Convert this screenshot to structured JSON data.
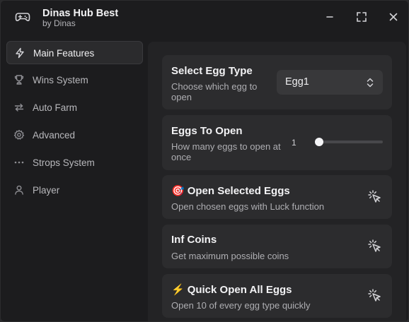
{
  "window": {
    "title": "Dinas Hub Best",
    "subtitle": "by Dinas",
    "icon": "gamepad-icon",
    "controls": [
      "minimize-icon",
      "maximize-icon",
      "close-icon"
    ]
  },
  "sidebar": {
    "items": [
      {
        "label": "Main Features",
        "icon": "lightning-icon",
        "active": true
      },
      {
        "label": "Wins System",
        "icon": "trophy-icon",
        "active": false
      },
      {
        "label": "Auto Farm",
        "icon": "repeat-icon",
        "active": false
      },
      {
        "label": "Advanced",
        "icon": "gear-icon",
        "active": false
      },
      {
        "label": "Strops System",
        "icon": "ellipsis-icon",
        "active": false
      },
      {
        "label": "Player",
        "icon": "user-icon",
        "active": false
      }
    ]
  },
  "main": {
    "egg_type": {
      "title": "Select Egg Type",
      "description": "Choose which egg to open",
      "selected": "Egg1"
    },
    "eggs_to_open": {
      "title": "Eggs To Open",
      "description": "How many eggs to open at once",
      "value": "1",
      "level": 0
    },
    "open_selected": {
      "emoji": "🎯",
      "title": "Open Selected Eggs",
      "description": "Open chosen eggs with Luck function"
    },
    "inf_coins": {
      "title": "Inf Coins",
      "description": "Get maximum possible coins"
    },
    "quick_open": {
      "emoji": "⚡",
      "title": "Quick Open All Eggs",
      "description": "Open 10 of every egg type quickly"
    }
  },
  "colors": {
    "window_bg": "#1c1c1e",
    "panel_bg": "#232325",
    "card_bg": "#2c2c2e",
    "text": "#f2f2f4",
    "muted_text": "#aeaeb2"
  }
}
